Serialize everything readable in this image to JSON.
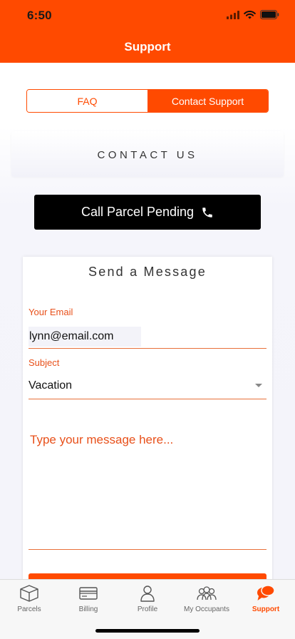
{
  "status_bar": {
    "time": "6:50"
  },
  "header": {
    "title": "Support"
  },
  "tabs_segment": {
    "faq_label": "FAQ",
    "contact_label": "Contact Support",
    "selected": "Contact Support"
  },
  "contact": {
    "title": "CONTACT US",
    "call_button_label": "Call Parcel Pending"
  },
  "message_form": {
    "title": "Send a Message",
    "email_label": "Your Email",
    "email_value": "lynn@email.com",
    "subject_label": "Subject",
    "subject_value": "Vacation",
    "message_placeholder": "Type your message here..."
  },
  "tab_bar": {
    "items": [
      {
        "label": "Parcels",
        "icon": "box-icon"
      },
      {
        "label": "Billing",
        "icon": "credit-card-icon"
      },
      {
        "label": "Profile",
        "icon": "person-icon"
      },
      {
        "label": "My Occupants",
        "icon": "group-icon"
      },
      {
        "label": "Support",
        "icon": "chat-bubbles-icon"
      }
    ],
    "active": "Support"
  },
  "colors": {
    "accent": "#FF4A00",
    "call_button": "#000000",
    "field_label": "#E8501A"
  }
}
